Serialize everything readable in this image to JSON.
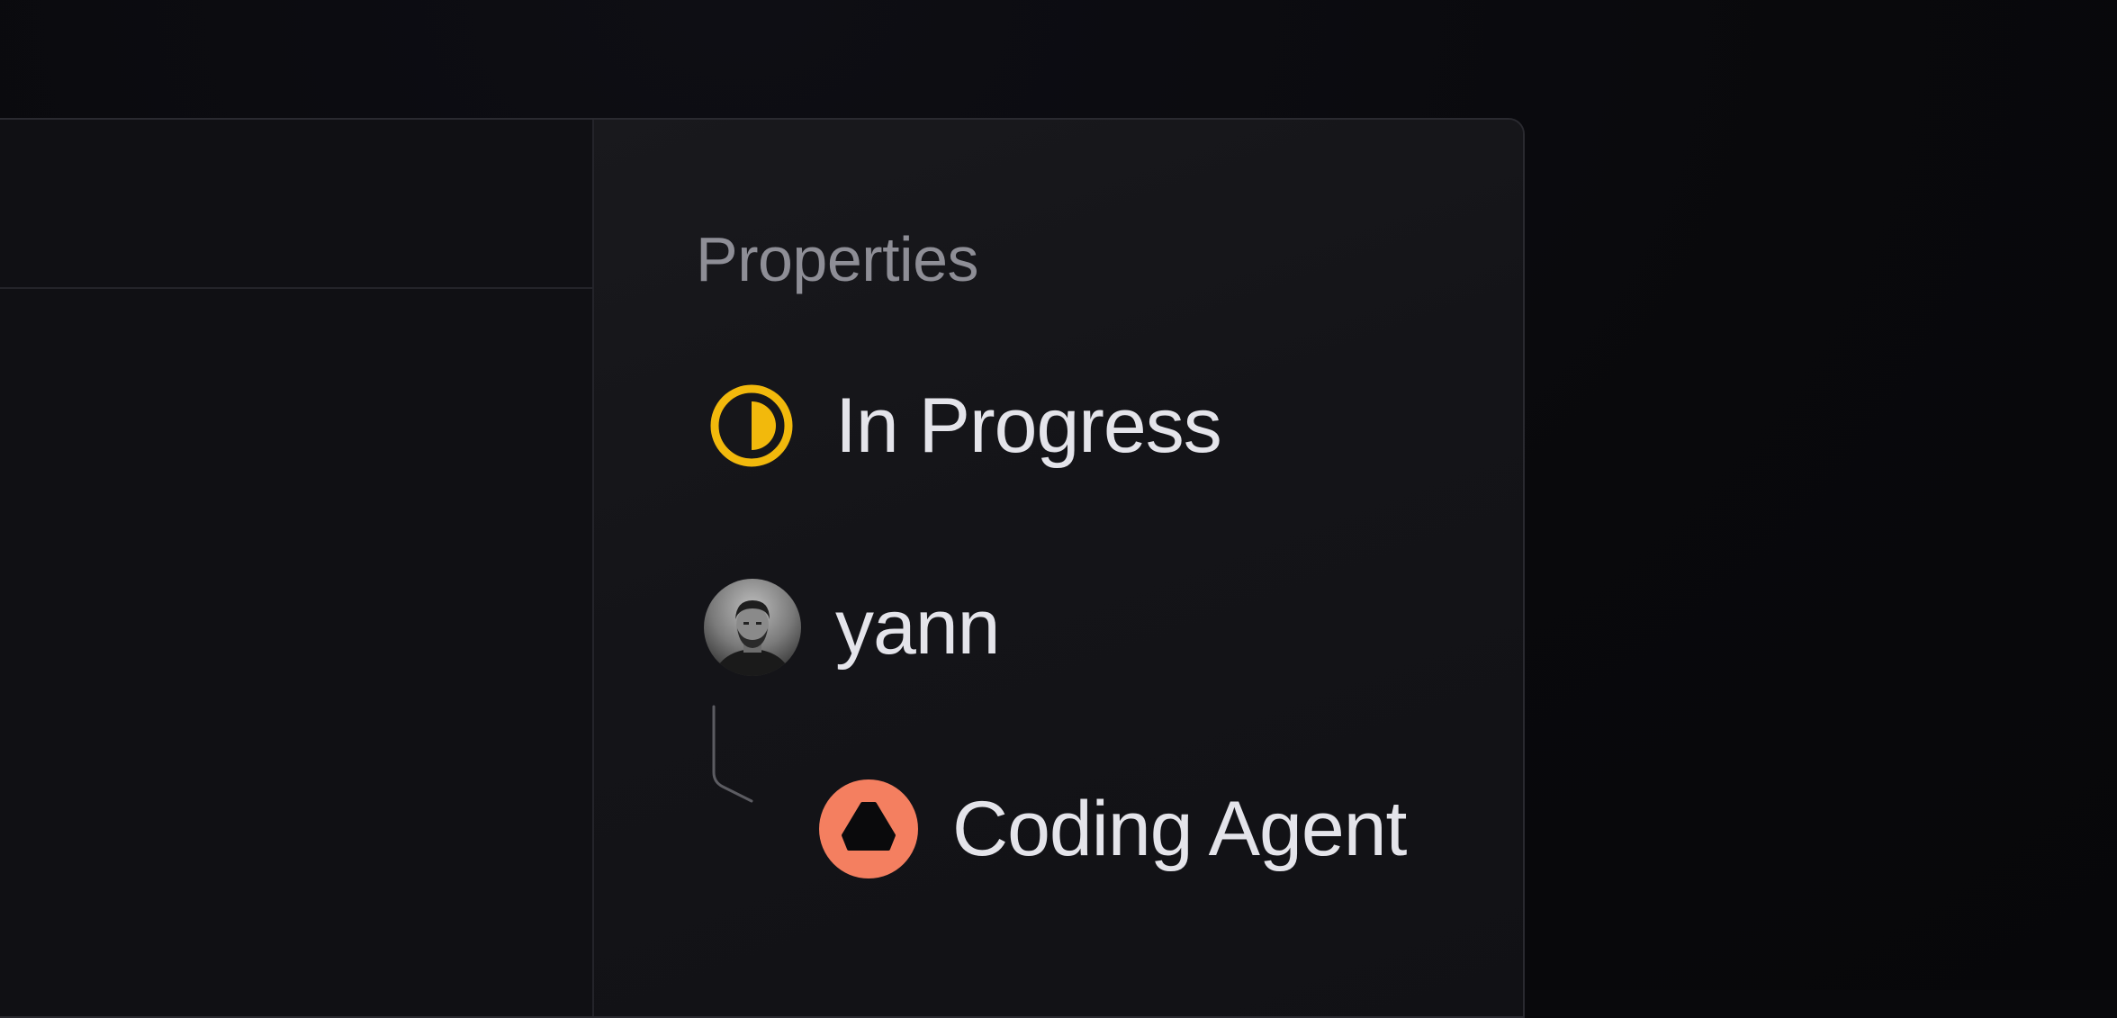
{
  "panel": {
    "title": "Properties"
  },
  "properties": {
    "status": {
      "label": "In Progress",
      "icon": "half-filled-circle-icon",
      "color": "#f2b90c"
    },
    "assignee": {
      "label": "yann",
      "icon": "user-avatar"
    },
    "delegate": {
      "label": "Coding Agent",
      "icon": "agent-hexagon-icon",
      "color": "#f47f60"
    }
  },
  "colors": {
    "background": "#09090c",
    "panel": "#141418",
    "border": "#2a2a30",
    "text_primary": "#e4e4ea",
    "text_secondary": "#8e8e96"
  }
}
